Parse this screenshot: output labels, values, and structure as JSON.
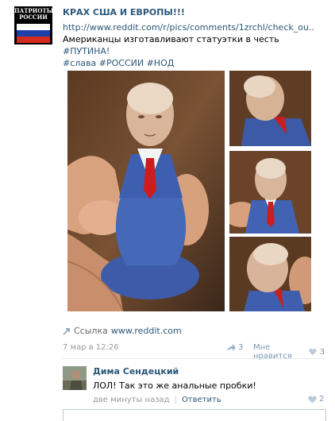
{
  "post": {
    "avatar_line1": "ПАТРИОТЫ",
    "avatar_line2": "РОССИИ",
    "author": "КРАХ США И ЕВРОПЫ!!!",
    "url": "http://www.reddit.com/r/pics/comments/1zrchl/check_ou..",
    "text": "Американцы изготавливают статуэтки в честь ",
    "text_tag": "#ПУТИНА!",
    "tags": [
      "#слава",
      "#РОССИИ",
      "#НОД"
    ],
    "attachment_label": "Ссылка",
    "attachment_domain": "www.reddit.com",
    "date": "7 мар в 12:26",
    "share_count": "3",
    "like_label": "Мне нравится",
    "like_count": "3"
  },
  "comment": {
    "author": "Дима Сендецкий",
    "text": "ЛОЛ! Так это же анальные пробки!",
    "time": "две минуты назад",
    "separator": "|",
    "reply_label": "Ответить",
    "like_count": "2"
  },
  "colors": {
    "link": "#2b587a",
    "meta": "#999999",
    "action": "#7b98b2"
  },
  "icons": [
    "link-icon",
    "share-icon",
    "heart-icon"
  ]
}
